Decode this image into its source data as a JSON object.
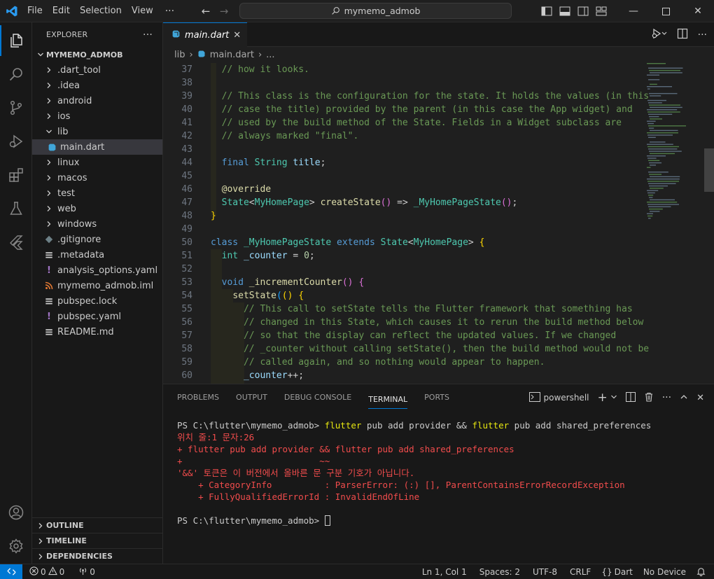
{
  "titlebar": {
    "menus": [
      "File",
      "Edit",
      "Selection",
      "View"
    ],
    "more": "···",
    "search_text": "mymemo_admob",
    "window_controls": [
      "minimize",
      "maximize",
      "close"
    ]
  },
  "activity_bar": [
    "explorer-icon",
    "search-icon",
    "source-control-icon",
    "run-debug-icon",
    "extensions-icon",
    "testing-icon",
    "flutter-icon",
    "account-icon",
    "settings-gear-icon"
  ],
  "sidebar": {
    "title": "EXPLORER",
    "more": "···",
    "project": "MYMEMO_ADMOB",
    "tree": [
      {
        "label": ".dart_tool",
        "type": "folder",
        "depth": 1
      },
      {
        "label": ".idea",
        "type": "folder",
        "depth": 1
      },
      {
        "label": "android",
        "type": "folder",
        "depth": 1
      },
      {
        "label": "ios",
        "type": "folder",
        "depth": 1
      },
      {
        "label": "lib",
        "type": "folder-open",
        "depth": 1
      },
      {
        "label": "main.dart",
        "type": "dart",
        "depth": 2,
        "selected": true
      },
      {
        "label": "linux",
        "type": "folder",
        "depth": 1
      },
      {
        "label": "macos",
        "type": "folder",
        "depth": 1
      },
      {
        "label": "test",
        "type": "folder",
        "depth": 1
      },
      {
        "label": "web",
        "type": "folder",
        "depth": 1
      },
      {
        "label": "windows",
        "type": "folder",
        "depth": 1
      },
      {
        "label": ".gitignore",
        "type": "git",
        "depth": 1
      },
      {
        "label": ".metadata",
        "type": "text",
        "depth": 1
      },
      {
        "label": "analysis_options.yaml",
        "type": "yaml",
        "depth": 1
      },
      {
        "label": "mymemo_admob.iml",
        "type": "rss",
        "depth": 1
      },
      {
        "label": "pubspec.lock",
        "type": "text",
        "depth": 1
      },
      {
        "label": "pubspec.yaml",
        "type": "yaml",
        "depth": 1
      },
      {
        "label": "README.md",
        "type": "text",
        "depth": 1
      }
    ],
    "bottom_sections": [
      "OUTLINE",
      "TIMELINE",
      "DEPENDENCIES"
    ]
  },
  "editor": {
    "tab_label": "main.dart",
    "tab_close": "✕",
    "breadcrumb": [
      "lib",
      "main.dart",
      "..."
    ],
    "lines": [
      {
        "n": "37",
        "tokens": [
          [
            "c-com",
            "  // how it looks."
          ]
        ]
      },
      {
        "n": "38",
        "tokens": []
      },
      {
        "n": "39",
        "tokens": [
          [
            "c-com",
            "  // This class is the configuration for the state. It holds the values (in this"
          ]
        ]
      },
      {
        "n": "40",
        "tokens": [
          [
            "c-com",
            "  // case the title) provided by the parent (in this case the App widget) and"
          ]
        ]
      },
      {
        "n": "41",
        "tokens": [
          [
            "c-com",
            "  // used by the build method of the State. Fields in a Widget subclass are"
          ]
        ]
      },
      {
        "n": "42",
        "tokens": [
          [
            "c-com",
            "  // always marked \"final\"."
          ]
        ]
      },
      {
        "n": "43",
        "tokens": []
      },
      {
        "n": "44",
        "tokens": [
          [
            "",
            "  "
          ],
          [
            "c-kw",
            "final"
          ],
          [
            "",
            " "
          ],
          [
            "c-ty",
            "String"
          ],
          [
            "",
            " "
          ],
          [
            "c-var",
            "title"
          ],
          [
            "",
            ";"
          ]
        ]
      },
      {
        "n": "45",
        "tokens": []
      },
      {
        "n": "46",
        "tokens": [
          [
            "",
            "  "
          ],
          [
            "c-fn",
            "@override"
          ]
        ]
      },
      {
        "n": "47",
        "tokens": [
          [
            "",
            "  "
          ],
          [
            "c-ty",
            "State"
          ],
          [
            "",
            "<"
          ],
          [
            "c-ty",
            "MyHomePage"
          ],
          [
            "",
            "> "
          ],
          [
            "c-fn",
            "createState"
          ],
          [
            "c-br2",
            "()"
          ],
          [
            "",
            " => "
          ],
          [
            "c-ty",
            "_MyHomePageState"
          ],
          [
            "c-br2",
            "()"
          ],
          [
            "",
            ";"
          ]
        ]
      },
      {
        "n": "48",
        "tokens": [
          [
            "c-br1",
            "}"
          ]
        ]
      },
      {
        "n": "49",
        "tokens": []
      },
      {
        "n": "50",
        "tokens": [
          [
            "c-kw",
            "class"
          ],
          [
            "",
            " "
          ],
          [
            "c-ty",
            "_MyHomePageState"
          ],
          [
            "",
            " "
          ],
          [
            "c-kw",
            "extends"
          ],
          [
            "",
            " "
          ],
          [
            "c-ty",
            "State"
          ],
          [
            "",
            "<"
          ],
          [
            "c-ty",
            "MyHomePage"
          ],
          [
            "",
            "> "
          ],
          [
            "c-br1",
            "{"
          ]
        ]
      },
      {
        "n": "51",
        "tokens": [
          [
            "",
            "  "
          ],
          [
            "c-ty",
            "int"
          ],
          [
            "",
            " "
          ],
          [
            "c-var",
            "_counter"
          ],
          [
            "",
            " = "
          ],
          [
            "c-num",
            "0"
          ],
          [
            "",
            ";"
          ]
        ]
      },
      {
        "n": "52",
        "tokens": []
      },
      {
        "n": "53",
        "tokens": [
          [
            "",
            "  "
          ],
          [
            "c-kw",
            "void"
          ],
          [
            "",
            " "
          ],
          [
            "c-fn",
            "_incrementCounter"
          ],
          [
            "c-br2",
            "()"
          ],
          [
            "",
            " "
          ],
          [
            "c-br2",
            "{"
          ]
        ]
      },
      {
        "n": "54",
        "tokens": [
          [
            "",
            "    "
          ],
          [
            "c-fn",
            "setState"
          ],
          [
            "c-br3",
            "("
          ],
          [
            "c-br1",
            "()"
          ],
          [
            "",
            " "
          ],
          [
            "c-br1",
            "{"
          ]
        ]
      },
      {
        "n": "55",
        "tokens": [
          [
            "c-com",
            "      // This call to setState tells the Flutter framework that something has"
          ]
        ]
      },
      {
        "n": "56",
        "tokens": [
          [
            "c-com",
            "      // changed in this State, which causes it to rerun the build method below"
          ]
        ]
      },
      {
        "n": "57",
        "tokens": [
          [
            "c-com",
            "      // so that the display can reflect the updated values. If we changed"
          ]
        ]
      },
      {
        "n": "58",
        "tokens": [
          [
            "c-com",
            "      // _counter without calling setState(), then the build method would not be"
          ]
        ]
      },
      {
        "n": "59",
        "tokens": [
          [
            "c-com",
            "      // called again, and so nothing would appear to happen."
          ]
        ]
      },
      {
        "n": "60",
        "tokens": [
          [
            "",
            "      "
          ],
          [
            "c-var",
            "_counter"
          ],
          [
            "",
            "++;"
          ]
        ]
      }
    ]
  },
  "panel": {
    "tabs": [
      "PROBLEMS",
      "OUTPUT",
      "DEBUG CONSOLE",
      "TERMINAL",
      "PORTS"
    ],
    "active_tab": "TERMINAL",
    "shell": "powershell",
    "terminal": {
      "prompt1": "PS C:\\flutter\\mymemo_admob> ",
      "cmd1_a": "flutter",
      "cmd1_b": " pub add provider && ",
      "cmd1_c": "flutter",
      "cmd1_d": " pub add shared_preferences",
      "err1": "위치 줄:1 문자:26",
      "err2": "+ flutter pub add provider && flutter pub add shared_preferences",
      "err3": "+                          ~~",
      "err4": "'&&' 토큰은 이 버전에서 올바른 문 구분 기호가 아닙니다.",
      "err5": "    + CategoryInfo          : ParserError: (:) [], ParentContainsErrorRecordException",
      "err6": "    + FullyQualifiedErrorId : InvalidEndOfLine",
      "prompt2": "PS C:\\flutter\\mymemo_admob> "
    }
  },
  "statusbar": {
    "remote_icon": "remote-icon",
    "errors": "0",
    "warnings": "0",
    "ports": "0",
    "cursor_pos": "Ln 1, Col 1",
    "spaces": "Spaces: 2",
    "encoding": "UTF-8",
    "eol": "CRLF",
    "language": "Dart",
    "device": "No Device"
  }
}
